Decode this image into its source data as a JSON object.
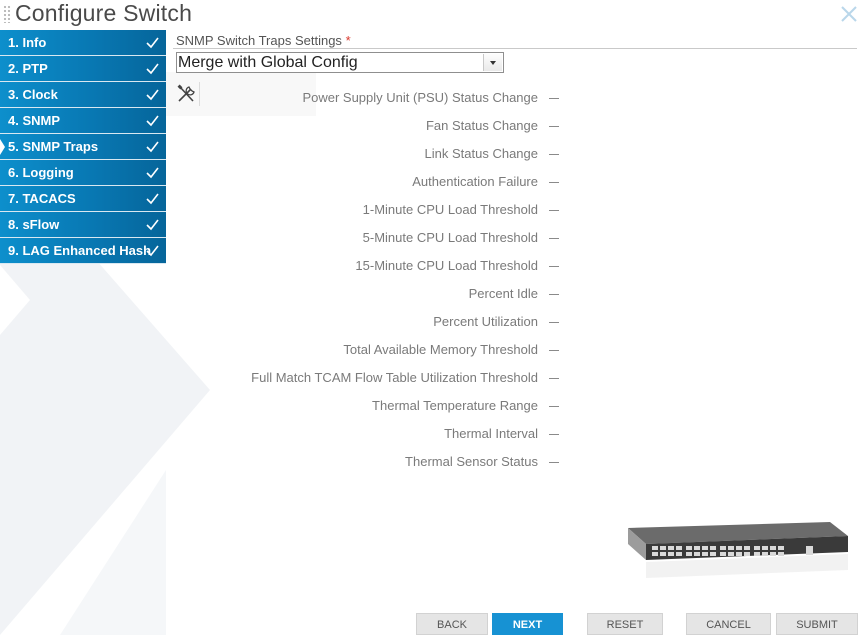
{
  "window": {
    "title": "Configure Switch"
  },
  "steps": [
    {
      "label": "1. Info",
      "done": true
    },
    {
      "label": "2. PTP",
      "done": true
    },
    {
      "label": "3. Clock",
      "done": true
    },
    {
      "label": "4. SNMP",
      "done": true
    },
    {
      "label": "5. SNMP Traps",
      "done": true,
      "active": true
    },
    {
      "label": "6. Logging",
      "done": true
    },
    {
      "label": "7. TACACS",
      "done": true
    },
    {
      "label": "8. sFlow",
      "done": true
    },
    {
      "label": "9. LAG Enhanced Hash",
      "done": true
    }
  ],
  "section": {
    "label": "SNMP Switch Traps Settings",
    "required_mark": "*"
  },
  "mode_select": {
    "value": "Merge with Global Config"
  },
  "traps": [
    {
      "label": "Power Supply Unit (PSU) Status Change",
      "value": "—"
    },
    {
      "label": "Fan Status Change",
      "value": "—"
    },
    {
      "label": "Link Status Change",
      "value": "—"
    },
    {
      "label": "Authentication Failure",
      "value": "—"
    },
    {
      "label": "1-Minute CPU Load Threshold",
      "value": "—"
    },
    {
      "label": "5-Minute CPU Load Threshold",
      "value": "—"
    },
    {
      "label": "15-Minute CPU Load Threshold",
      "value": "—"
    },
    {
      "label": "Percent Idle",
      "value": "—"
    },
    {
      "label": "Percent Utilization",
      "value": "—"
    },
    {
      "label": "Total Available Memory Threshold",
      "value": "—"
    },
    {
      "label": "Full Match TCAM Flow Table Utilization Threshold",
      "value": "—"
    },
    {
      "label": "Thermal Temperature Range",
      "value": "—"
    },
    {
      "label": "Thermal Interval",
      "value": "—"
    },
    {
      "label": "Thermal Sensor Status",
      "value": "—"
    }
  ],
  "buttons": {
    "back": "BACK",
    "next": "NEXT",
    "reset": "RESET",
    "cancel": "CANCEL",
    "submit": "SUBMIT"
  },
  "colors": {
    "step_blue": "#0878b3",
    "primary_button": "#1792d3",
    "required": "#d9372c"
  },
  "icons": {
    "close": "close-icon",
    "check": "check-icon",
    "tools": "tools-icon",
    "dropdown": "chevron-down-icon"
  }
}
